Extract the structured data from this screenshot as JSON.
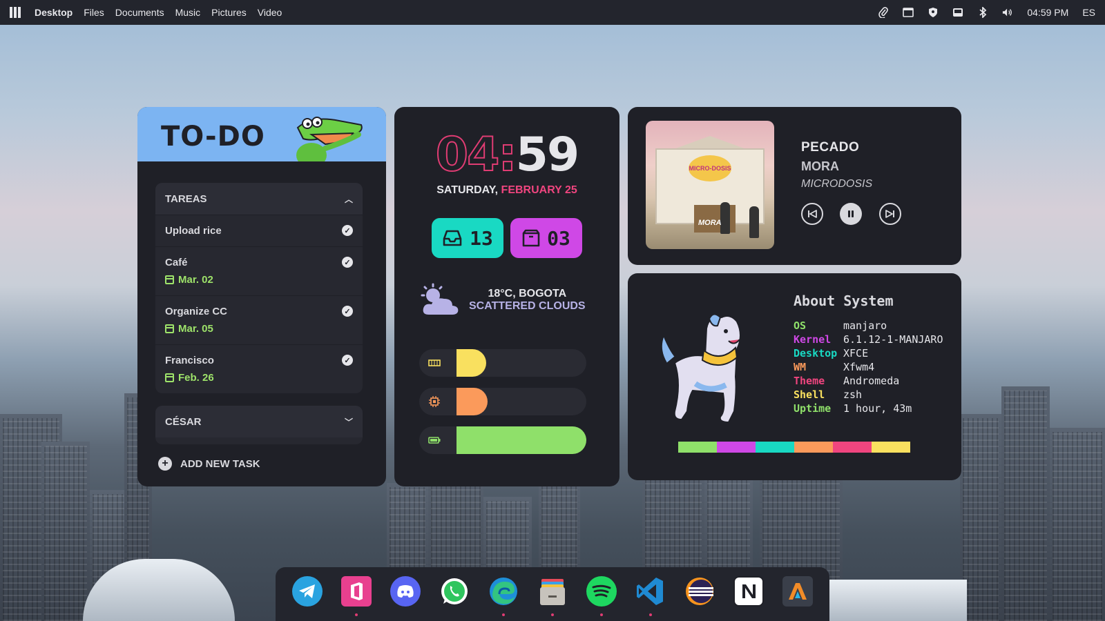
{
  "topbar": {
    "menu": [
      "Desktop",
      "Files",
      "Documents",
      "Music",
      "Pictures",
      "Video"
    ],
    "tray_icons": [
      "paperclip-icon",
      "screen-icon",
      "shield-icon",
      "drive-icon",
      "bluetooth-icon",
      "volume-icon"
    ],
    "time": "04:59 PM",
    "lang": "ES"
  },
  "todo": {
    "title": "TO-DO",
    "sections": [
      {
        "name": "TAREAS",
        "tasks": [
          {
            "name": "Upload rice",
            "date": ""
          },
          {
            "name": "Café",
            "date": "Mar. 02"
          },
          {
            "name": "Organize CC",
            "date": "Mar. 05"
          },
          {
            "name": "Francisco",
            "date": "Feb. 26"
          }
        ]
      },
      {
        "name": "CÉSAR"
      }
    ],
    "add_label": "ADD NEW TASK"
  },
  "clock": {
    "hour": "04",
    "minute": "59",
    "day": "SATURDAY,",
    "date": "FEBRUARY 25",
    "inbox_count": "13",
    "package_count": "03",
    "weather_line1": "18°C, BOGOTA",
    "weather_line2": "SCATTERED CLOUDS",
    "meters": [
      {
        "icon": "memory-icon",
        "level": 0.23,
        "color": "#f9e05f"
      },
      {
        "icon": "cpu-icon",
        "level": 0.24,
        "color": "#fb9a5b"
      },
      {
        "icon": "battery-icon",
        "level": 1.0,
        "color": "#8fe06a"
      }
    ]
  },
  "music": {
    "title": "PECADO",
    "artist": "MORA",
    "album": "MICRODOSIS",
    "cover_sign": "MICRO-DOSIS",
    "cover_brand": "MORA"
  },
  "about": {
    "title": "About System",
    "rows": [
      {
        "key": "OS",
        "value": "manjaro",
        "color": "#8fe06a"
      },
      {
        "key": "Kernel",
        "value": "6.1.12-1-MANJARO",
        "color": "#cf48e6"
      },
      {
        "key": "Desktop",
        "value": "XFCE",
        "color": "#19d9c3"
      },
      {
        "key": "WM",
        "value": "Xfwm4",
        "color": "#fb9a5b"
      },
      {
        "key": "Theme",
        "value": "Andromeda",
        "color": "#f0457f"
      },
      {
        "key": "Shell",
        "value": "zsh",
        "color": "#f9e05f"
      },
      {
        "key": "Uptime",
        "value": "1 hour, 43m",
        "color": "#8fe06a"
      }
    ],
    "palette": [
      "#8fe06a",
      "#cf48e6",
      "#19d9c3",
      "#fb9a5b",
      "#f0457f",
      "#f9e05f"
    ]
  },
  "dock": {
    "apps": [
      {
        "name": "telegram-icon",
        "running": false
      },
      {
        "name": "office-icon",
        "running": true
      },
      {
        "name": "discord-icon",
        "running": false
      },
      {
        "name": "whatsapp-icon",
        "running": false
      },
      {
        "name": "edge-icon",
        "running": true
      },
      {
        "name": "files-icon",
        "running": true
      },
      {
        "name": "spotify-icon",
        "running": true
      },
      {
        "name": "vscode-icon",
        "running": true
      },
      {
        "name": "eclipse-icon",
        "running": false
      },
      {
        "name": "notion-icon",
        "running": false
      },
      {
        "name": "alacritty-icon",
        "running": false
      }
    ]
  }
}
